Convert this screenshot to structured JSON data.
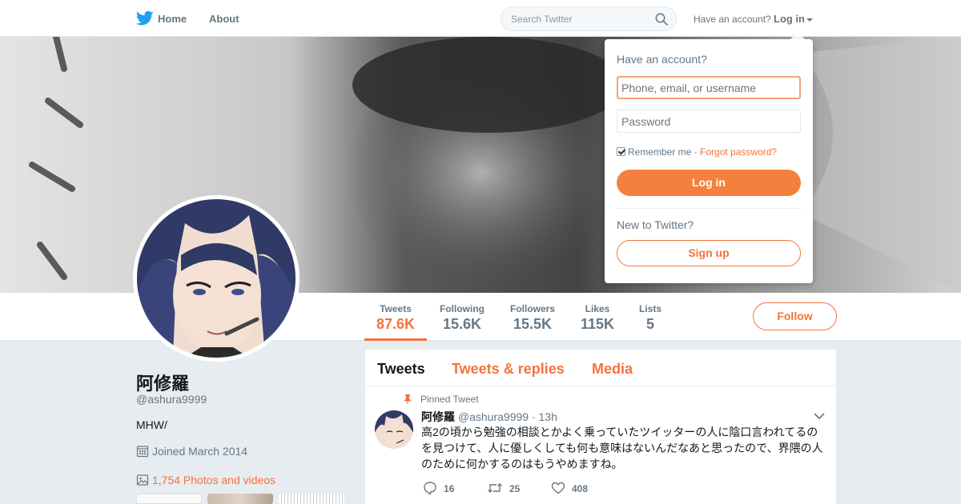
{
  "nav": {
    "home_label": "Home",
    "about_label": "About",
    "search_placeholder": "Search Twitter",
    "have_account": "Have an account?",
    "login_label": "Log in"
  },
  "profile": {
    "name": "阿修羅",
    "handle": "@ashura9999",
    "bio": "MHW/",
    "joined": "Joined March 2014",
    "photos": "1,754 Photos and videos",
    "follow_label": "Follow"
  },
  "stats": [
    {
      "label": "Tweets",
      "value": "87.6K",
      "active": true
    },
    {
      "label": "Following",
      "value": "15.6K"
    },
    {
      "label": "Followers",
      "value": "15.5K"
    },
    {
      "label": "Likes",
      "value": "115K"
    },
    {
      "label": "Lists",
      "value": "5"
    }
  ],
  "timeline": {
    "tabs": [
      {
        "label": "Tweets",
        "active": true
      },
      {
        "label": "Tweets & replies"
      },
      {
        "label": "Media"
      }
    ],
    "pinned_label": "Pinned Tweet",
    "tweet": {
      "name": "阿修羅",
      "handle": "@ashura9999",
      "dot": "·",
      "time": "13h",
      "text": "高2の頃から勉強の相談とかよく乗っていたツイッターの人に陰口言われてるのを見つけて、人に優しくしても何も意味はないんだなあと思ったので、界隈の人のために何かするのはもうやめますね。",
      "replies": "16",
      "retweets": "25",
      "likes": "408"
    }
  },
  "login_dropdown": {
    "title": "Have an account?",
    "username_placeholder": "Phone, email, or username",
    "password_placeholder": "Password",
    "remember": "Remember me",
    "separator": "·",
    "forgot": "Forgot password?",
    "login_button": "Log in",
    "new_to": "New to Twitter?",
    "signup_button": "Sign up"
  },
  "colors": {
    "accent": "#f5723d",
    "twitter_blue": "#1da1f2",
    "text_secondary": "#657786"
  }
}
